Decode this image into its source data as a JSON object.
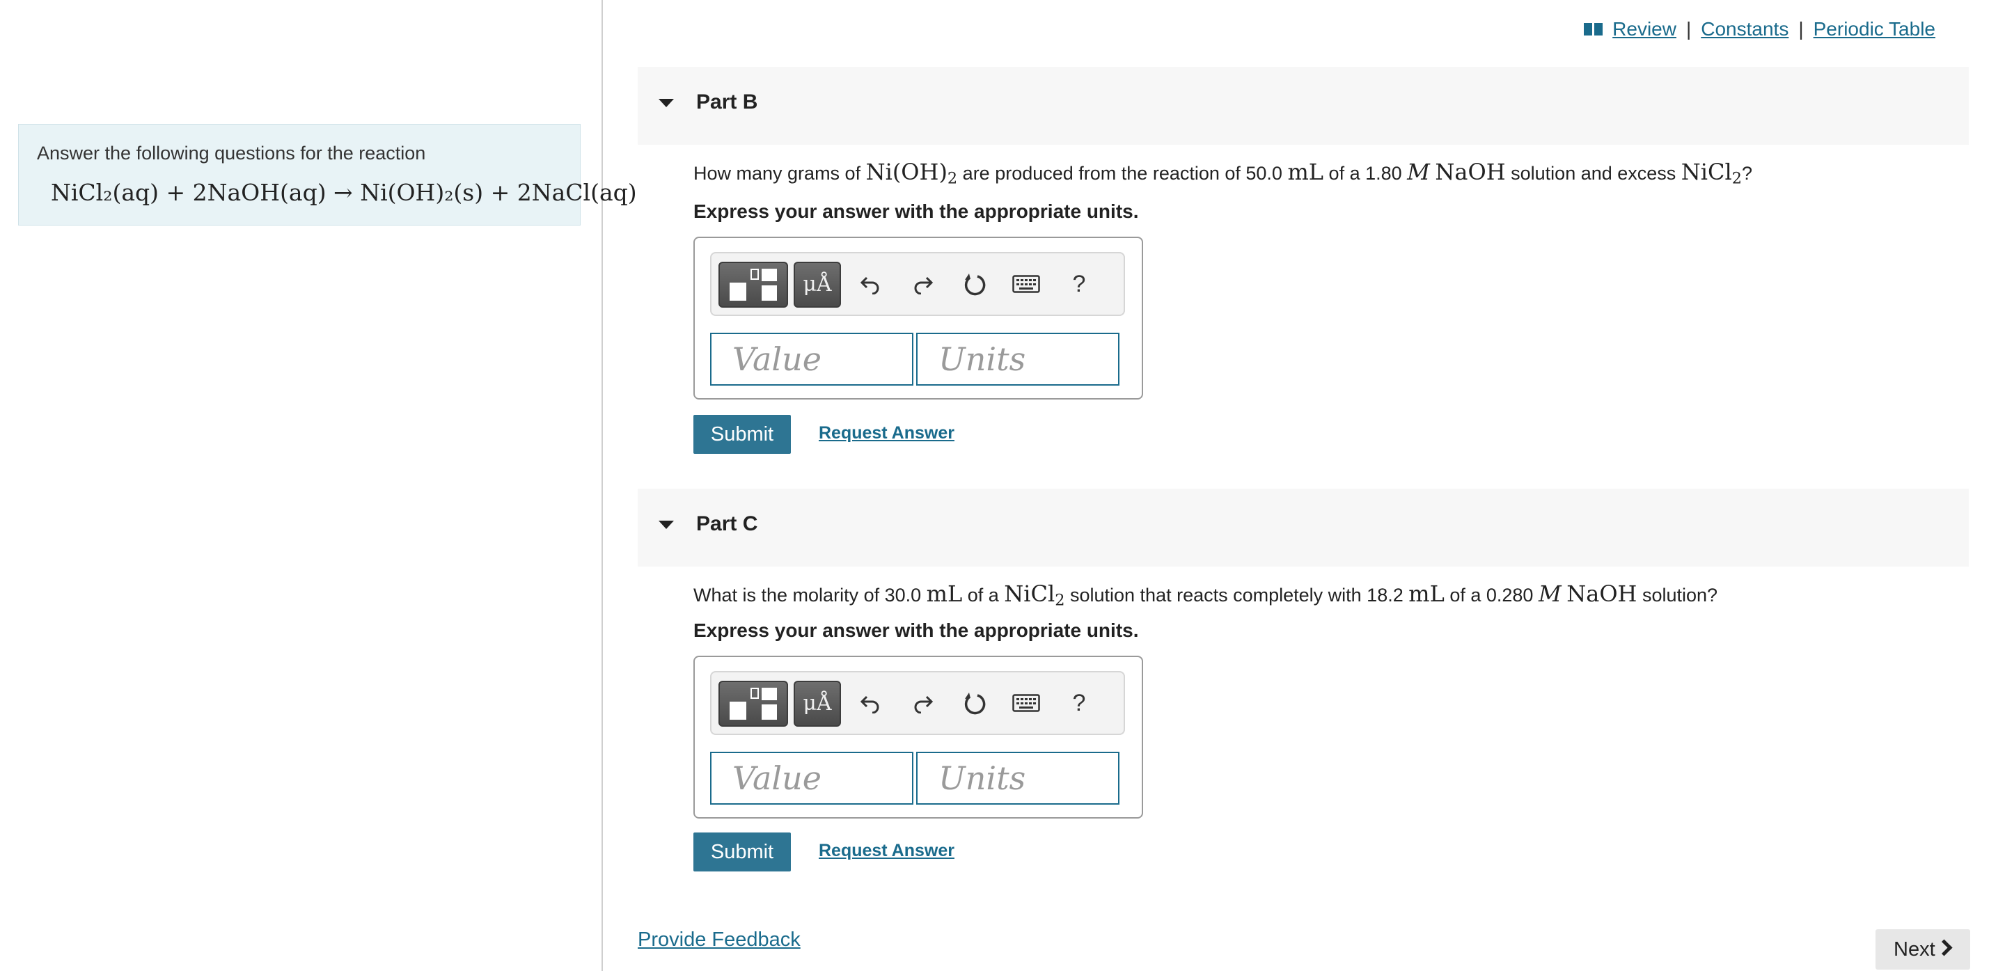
{
  "top_links": {
    "review": "Review",
    "constants": "Constants",
    "periodic_table": "Periodic Table",
    "separator": "|"
  },
  "intro": {
    "text": "Answer the following questions for the reaction",
    "reaction": "NiCl₂(aq) + 2NaOH(aq) → Ni(OH)₂(s) + 2NaCl(aq)"
  },
  "parts": [
    {
      "title": "Part B",
      "question": {
        "t1": "How many grams of ",
        "m1": "Ni(OH)",
        "m1_sub": "2",
        "t2": " are produced from the reaction of 50.0 ",
        "m2": "mL",
        "t3": " of a 1.80 ",
        "m3": "M",
        "m4": "NaOH",
        "t4": " solution and excess ",
        "m5": "NiCl",
        "m5_sub": "2",
        "t5": "?"
      },
      "instruction": "Express your answer with the appropriate units.",
      "toolbar": {
        "symbols_label": "μÅ",
        "help_label": "?"
      },
      "value_placeholder": "Value",
      "units_placeholder": "Units",
      "submit_label": "Submit",
      "request_label": "Request Answer"
    },
    {
      "title": "Part C",
      "question": {
        "t1": "What is the molarity of 30.0 ",
        "m1": "mL",
        "t2": " of a ",
        "m2": "NiCl",
        "m2_sub": "2",
        "t3": " solution that reacts completely with 18.2 ",
        "m3": "mL",
        "t4": " of a 0.280 ",
        "m4": "M",
        "m5": "NaOH",
        "t5": " solution?"
      },
      "instruction": "Express your answer with the appropriate units.",
      "toolbar": {
        "symbols_label": "μÅ",
        "help_label": "?"
      },
      "value_placeholder": "Value",
      "units_placeholder": "Units",
      "submit_label": "Submit",
      "request_label": "Request Answer"
    }
  ],
  "footer": {
    "feedback": "Provide Feedback",
    "next": "Next"
  },
  "colors": {
    "link": "#1a6b8c",
    "submit_bg": "#2e7593",
    "intro_bg": "#e8f3f6",
    "part_header_bg": "#f7f7f7"
  }
}
